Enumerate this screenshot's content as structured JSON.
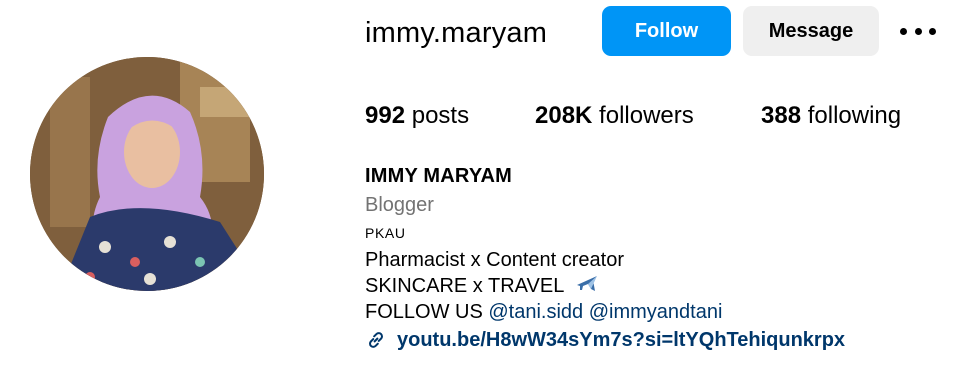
{
  "profile": {
    "username": "immy.maryam",
    "follow_label": "Follow",
    "message_label": "Message",
    "more_icon": "more-options-icon",
    "avatar_icon": "profile-photo"
  },
  "stats": {
    "posts_count": "992",
    "posts_label": "posts",
    "followers_count": "208K",
    "followers_label": "followers",
    "following_count": "388",
    "following_label": "following"
  },
  "bio": {
    "full_name": "IMMY MARYAM",
    "category": "Blogger",
    "tag": "PKAU",
    "line1": "Pharmacist x Content creator",
    "line2": "SKINCARE x TRAVEL",
    "line2_icon": "airplane-icon",
    "line3_prefix": "FOLLOW US",
    "mention1": "@tani.sidd",
    "mention2": "@immyandtani",
    "link": "youtu.be/H8wW34sYm7s?si=ltYQhTehiqunkrpx",
    "link_icon": "link-icon"
  },
  "colors": {
    "primary_button": "#0095f6",
    "secondary_button": "#efefef",
    "secondary_text": "#737373",
    "link_text": "#00376b"
  }
}
